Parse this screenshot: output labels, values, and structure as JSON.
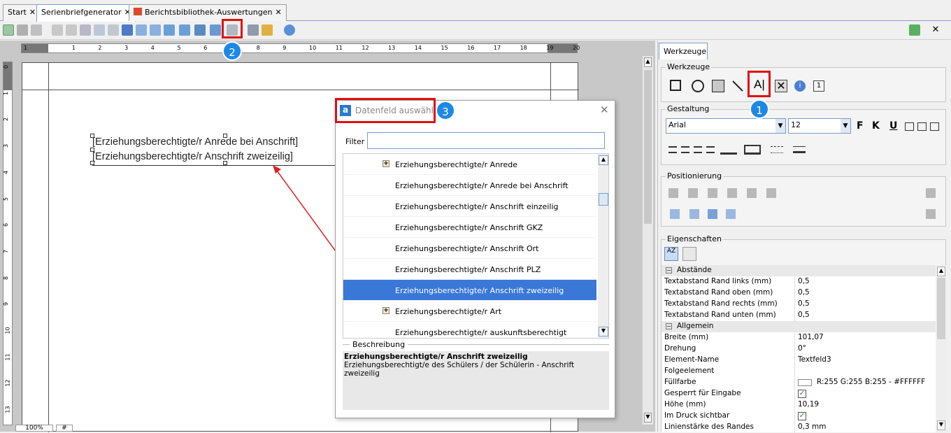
{
  "tabs": [
    {
      "label": "Start"
    },
    {
      "label": "Serienbriefgenerator"
    },
    {
      "label": "Berichtsbibliothek-Auswertungen"
    }
  ],
  "ruler": {
    "h_ticks": [
      "1",
      "1",
      "2",
      "3",
      "4",
      "5",
      "6",
      "7",
      "8",
      "9",
      "10",
      "11",
      "12",
      "13",
      "14",
      "15",
      "16",
      "17",
      "18",
      "19",
      "20"
    ],
    "v_ticks": [
      "0",
      "1",
      "2",
      "3",
      "4",
      "5",
      "6",
      "7",
      "8",
      "9",
      "10",
      "11",
      "12",
      "13"
    ]
  },
  "document": {
    "line1": "[Erziehungsberechtigte/r Anrede bei Anschrift]",
    "line2": "[Erziehungsberechtigte/r Anschrift zweizeilig]"
  },
  "status": {
    "zoom": "100%",
    "marker": "#"
  },
  "dialog": {
    "title": "Datenfeld auswählen",
    "filter_label": "Filter",
    "filter_value": "",
    "items": [
      {
        "label": "Erziehungsberechtigte/r Anrede",
        "expandable": "+"
      },
      {
        "label": "Erziehungsberechtigte/r Anrede bei Anschrift",
        "expandable": ""
      },
      {
        "label": "Erziehungsberechtigte/r Anschrift einzeilig",
        "expandable": ""
      },
      {
        "label": "Erziehungsberechtigte/r Anschrift GKZ",
        "expandable": ""
      },
      {
        "label": "Erziehungsberechtigte/r Anschrift Ort",
        "expandable": ""
      },
      {
        "label": "Erziehungsberechtigte/r Anschrift PLZ",
        "expandable": ""
      },
      {
        "label": "Erziehungsberechtigte/r Anschrift zweizeilig",
        "expandable": ""
      },
      {
        "label": "Erziehungsberechtigte/r Art",
        "expandable": "+"
      },
      {
        "label": "Erziehungsberechtigte/r auskunftsberechtigt",
        "expandable": ""
      }
    ],
    "desc_label": "Beschreibung",
    "desc_title": "Erziehungsberechtigte/r Anschrift zweizeilig",
    "desc_text": "Erziehungsberechtigt/e des Schülers / der Schülerin - Anschrift zweizeilig"
  },
  "badges": {
    "b1": "1",
    "b2": "2",
    "b3": "3"
  },
  "panel": {
    "tab": "Werkzeuge",
    "werkzeuge": "Werkzeuge",
    "gestaltung": "Gestaltung",
    "font": "Arial",
    "size": "12",
    "fmt": {
      "bold": "F",
      "italic": "K",
      "underline": "U"
    },
    "positionierung": "Positionierung",
    "eigenschaften": "Eigenschaften",
    "cat1": "Abstände",
    "cat2": "Allgemein",
    "props": [
      {
        "k": "Textabstand Rand links (mm)",
        "v": "0,5"
      },
      {
        "k": "Textabstand Rand oben (mm)",
        "v": "0,5"
      },
      {
        "k": "Textabstand Rand rechts (mm)",
        "v": "0,5"
      },
      {
        "k": "Textabstand Rand unten (mm)",
        "v": "0,5"
      }
    ],
    "props2": [
      {
        "k": "Breite (mm)",
        "v": "101,07"
      },
      {
        "k": "Drehung",
        "v": "0°"
      },
      {
        "k": "Element-Name",
        "v": "Textfeld3"
      },
      {
        "k": "Folgeelement",
        "v": ""
      },
      {
        "k": "Füllfarbe",
        "v": "R:255 G:255 B:255 - #FFFFFF"
      },
      {
        "k": "Gesperrt für Eingabe",
        "v": "✓"
      },
      {
        "k": "Höhe (mm)",
        "v": "10,19"
      },
      {
        "k": "Im Druck sichtbar",
        "v": "✓"
      },
      {
        "k": "Linienstärke des Randes",
        "v": "0,3 mm"
      }
    ]
  },
  "colors": {
    "accent": "#3a78d8",
    "highlight": "#e01010",
    "badge": "#1e88e5"
  }
}
